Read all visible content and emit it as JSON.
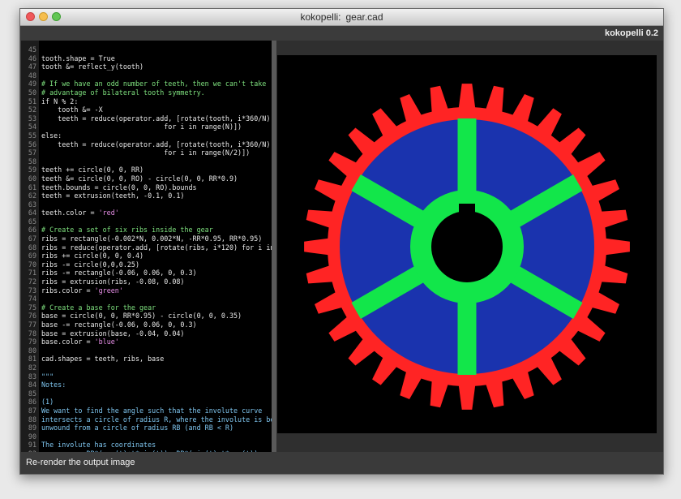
{
  "window": {
    "title_app": "kokopelli:",
    "title_file": "gear.cad",
    "app_name": "kokopelli 0.2",
    "status": "Re-render the output image"
  },
  "editor": {
    "lines": [
      {
        "n": "45",
        "t": "",
        "k": "code"
      },
      {
        "n": "46",
        "t": "tooth.shape = True",
        "k": "code"
      },
      {
        "n": "47",
        "t": "tooth &= reflect_y(tooth)",
        "k": "code"
      },
      {
        "n": "48",
        "t": "",
        "k": "code"
      },
      {
        "n": "49",
        "t": "# If we have an odd number of teeth, then we can't take",
        "k": "comment"
      },
      {
        "n": "50",
        "t": "# advantage of bilateral tooth symmetry.",
        "k": "comment"
      },
      {
        "n": "51",
        "t": "if N % 2:",
        "k": "code"
      },
      {
        "n": "52",
        "t": "    tooth &= -X",
        "k": "code"
      },
      {
        "n": "53",
        "t": "    teeth = reduce(operator.add, [rotate(tooth, i*360/N)",
        "k": "code"
      },
      {
        "n": "54",
        "t": "                              for i in range(N)])",
        "k": "code"
      },
      {
        "n": "55",
        "t": "else:",
        "k": "code"
      },
      {
        "n": "56",
        "t": "    teeth = reduce(operator.add, [rotate(tooth, i*360/N)",
        "k": "code"
      },
      {
        "n": "57",
        "t": "                              for i in range(N/2)])",
        "k": "code"
      },
      {
        "n": "58",
        "t": "",
        "k": "code"
      },
      {
        "n": "59",
        "t": "teeth += circle(0, 0, RR)",
        "k": "code"
      },
      {
        "n": "60",
        "t": "teeth &= circle(0, 0, RO) - circle(0, 0, RR*0.9)",
        "k": "code"
      },
      {
        "n": "61",
        "t": "teeth.bounds = circle(0, 0, RO).bounds",
        "k": "code"
      },
      {
        "n": "62",
        "t": "teeth = extrusion(teeth, -0.1, 0.1)",
        "k": "code"
      },
      {
        "n": "63",
        "t": "",
        "k": "code"
      },
      {
        "n": "64",
        "pre": "teeth.color = ",
        "str": "'red'",
        "k": "mixed"
      },
      {
        "n": "65",
        "t": "",
        "k": "code"
      },
      {
        "n": "66",
        "t": "# Create a set of six ribs inside the gear",
        "k": "comment"
      },
      {
        "n": "67",
        "t": "ribs = rectangle(-0.002*N, 0.002*N, -RR*0.95, RR*0.95)",
        "k": "code"
      },
      {
        "n": "68",
        "t": "ribs = reduce(operator.add, [rotate(ribs, i*120) for i in ra",
        "k": "code"
      },
      {
        "n": "69",
        "t": "ribs += circle(0, 0, 0.4)",
        "k": "code"
      },
      {
        "n": "70",
        "t": "ribs -= circle(0,0,0.25)",
        "k": "code"
      },
      {
        "n": "71",
        "t": "ribs -= rectangle(-0.06, 0.06, 0, 0.3)",
        "k": "code"
      },
      {
        "n": "72",
        "t": "ribs = extrusion(ribs, -0.08, 0.08)",
        "k": "code"
      },
      {
        "n": "73",
        "pre": "ribs.color = ",
        "str": "'green'",
        "k": "mixed"
      },
      {
        "n": "74",
        "t": "",
        "k": "code"
      },
      {
        "n": "75",
        "t": "# Create a base for the gear",
        "k": "comment"
      },
      {
        "n": "76",
        "t": "base = circle(0, 0, RR*0.95) - circle(0, 0, 0.35)",
        "k": "code"
      },
      {
        "n": "77",
        "t": "base -= rectangle(-0.06, 0.06, 0, 0.3)",
        "k": "code"
      },
      {
        "n": "78",
        "t": "base = extrusion(base, -0.04, 0.04)",
        "k": "code"
      },
      {
        "n": "79",
        "pre": "base.color = ",
        "str": "'blue'",
        "k": "mixed"
      },
      {
        "n": "80",
        "t": "",
        "k": "code"
      },
      {
        "n": "81",
        "t": "cad.shapes = teeth, ribs, base",
        "k": "code"
      },
      {
        "n": "82",
        "t": "",
        "k": "code"
      },
      {
        "n": "83",
        "t": "\"\"\"",
        "k": "doc"
      },
      {
        "n": "84",
        "t": "Notes:",
        "k": "doc"
      },
      {
        "n": "85",
        "t": "",
        "k": "doc"
      },
      {
        "n": "86",
        "t": "(1)",
        "k": "doc"
      },
      {
        "n": "87",
        "t": "We want to find the angle such that the involute curve",
        "k": "doc"
      },
      {
        "n": "88",
        "t": "intersects a circle of radius R, where the involute is being",
        "k": "doc"
      },
      {
        "n": "89",
        "t": "unwound from a circle of radius RB (and RB < R)",
        "k": "doc"
      },
      {
        "n": "90",
        "t": "",
        "k": "doc"
      },
      {
        "n": "91",
        "t": "The involute has coordinates",
        "k": "doc"
      },
      {
        "n": "92",
        "t": "    x, y = RB*(cos(t)+t*sin(t)), RB*(sin(t)-t*cos(t))",
        "k": "doc"
      }
    ]
  },
  "render": {
    "colors": {
      "teeth": "#ff2424",
      "base": "#1a33ae",
      "ribs": "#12e64a",
      "background": "#000000"
    },
    "tooth_count": 32,
    "rib_count": 6
  }
}
